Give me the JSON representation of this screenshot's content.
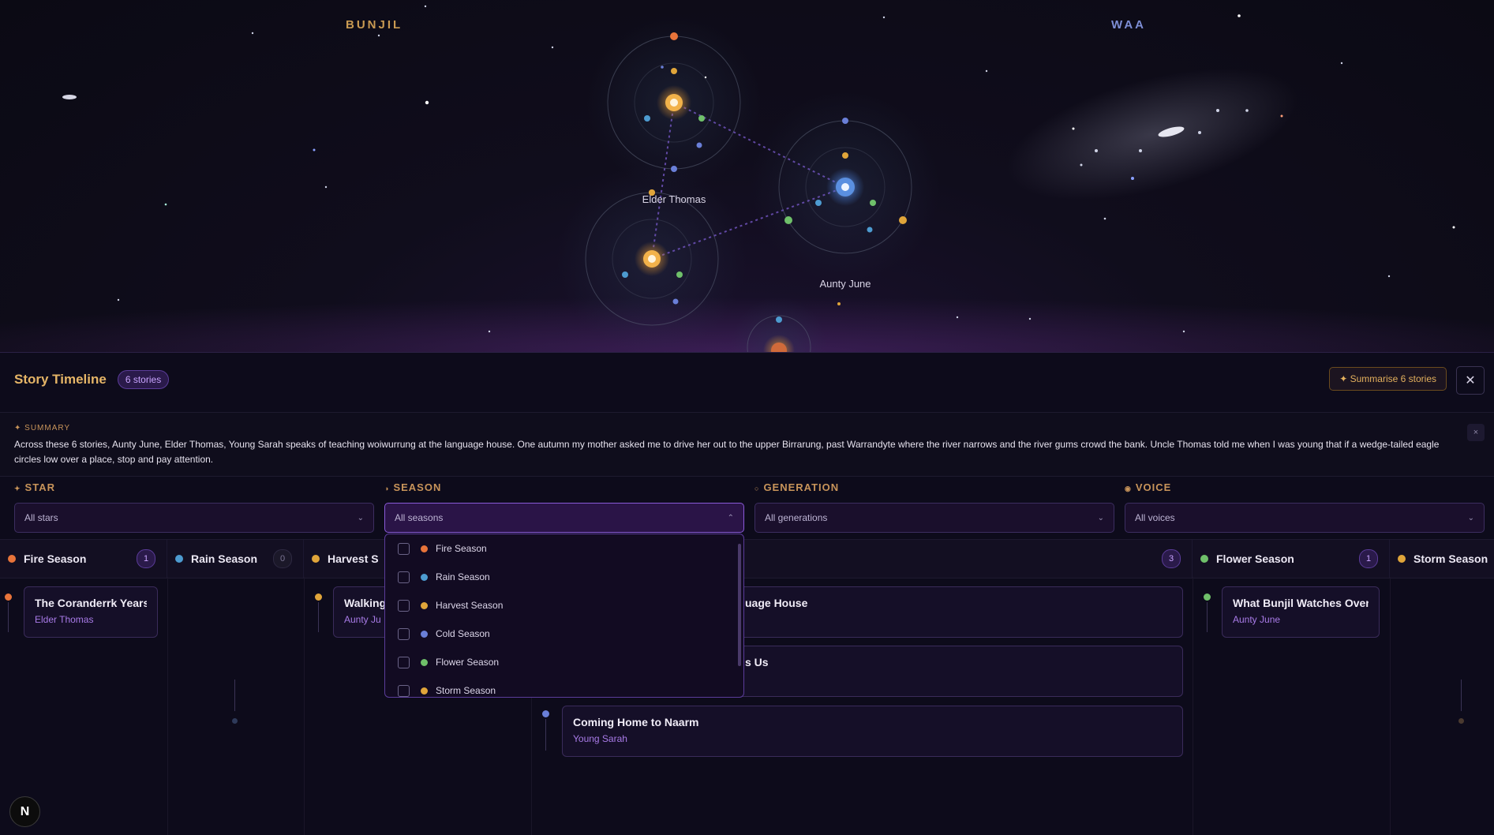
{
  "sky": {
    "labels": {
      "left": "BUNJIL",
      "right": "WAA"
    },
    "people": {
      "elder": "Elder Thomas",
      "aunty": "Aunty June"
    }
  },
  "timeline": {
    "title": "Story Timeline",
    "count_badge": "6 stories",
    "summarise_button": "✦ Summarise 6 stories",
    "close_label": "✕"
  },
  "summary": {
    "label": "✦ SUMMARY",
    "text": "Across these 6 stories, Aunty June, Elder Thomas, Young Sarah speaks of teaching woiwurrung at the language house. One autumn my mother asked me to drive her out to the upper Birrarung, past Warrandyte where the river narrows and the river gums crowd the bank. Uncle Thomas told me when I was young that if a wedge-tailed eagle circles low over a place, stop and pay attention.",
    "dismiss": "×"
  },
  "filters": [
    {
      "label": "STAR",
      "icon": "✦",
      "value": "All stars",
      "color": "#c8945a"
    },
    {
      "label": "SEASON",
      "icon": "◑",
      "value": "All seasons",
      "color": "#c8945a"
    },
    {
      "label": "GENERATION",
      "icon": "○",
      "value": "All generations",
      "color": "#c8945a"
    },
    {
      "label": "VOICE",
      "icon": "◉",
      "value": "All voices",
      "color": "#c8945a"
    }
  ],
  "season_options": [
    {
      "label": "Fire Season",
      "color": "#e8743a"
    },
    {
      "label": "Rain Season",
      "color": "#4d9bd0"
    },
    {
      "label": "Harvest Season",
      "color": "#e0a53a"
    },
    {
      "label": "Cold Season",
      "color": "#6a7fd8"
    },
    {
      "label": "Flower Season",
      "color": "#6fc06a"
    },
    {
      "label": "Storm Season",
      "color": "#e0a53a"
    }
  ],
  "columns": [
    {
      "name": "Fire Season",
      "count": "1",
      "color": "#e8743a"
    },
    {
      "name": "Rain Season",
      "count": "0",
      "color": "#4d9bd0"
    },
    {
      "name": "Harvest S",
      "count": "",
      "color": "#e0a53a"
    },
    {
      "name": "",
      "count": "3",
      "color": "#6a7fd8"
    },
    {
      "name": "Flower Season",
      "count": "1",
      "color": "#6fc06a"
    },
    {
      "name": "Storm Season",
      "count": "",
      "color": "#e0a53a"
    }
  ],
  "cards": [
    {
      "title": "The Coranderrk Years",
      "author": "Elder Thomas"
    },
    {
      "title": "Walking",
      "author": "Aunty Ju"
    },
    {
      "title": "uage House",
      "author": ""
    },
    {
      "title": "s Us",
      "author": ""
    },
    {
      "title": "Coming Home to Naarm",
      "author": "Young Sarah"
    },
    {
      "title": "What Bunjil Watches Over",
      "author": "Aunty June"
    }
  ],
  "corner_button": "N"
}
